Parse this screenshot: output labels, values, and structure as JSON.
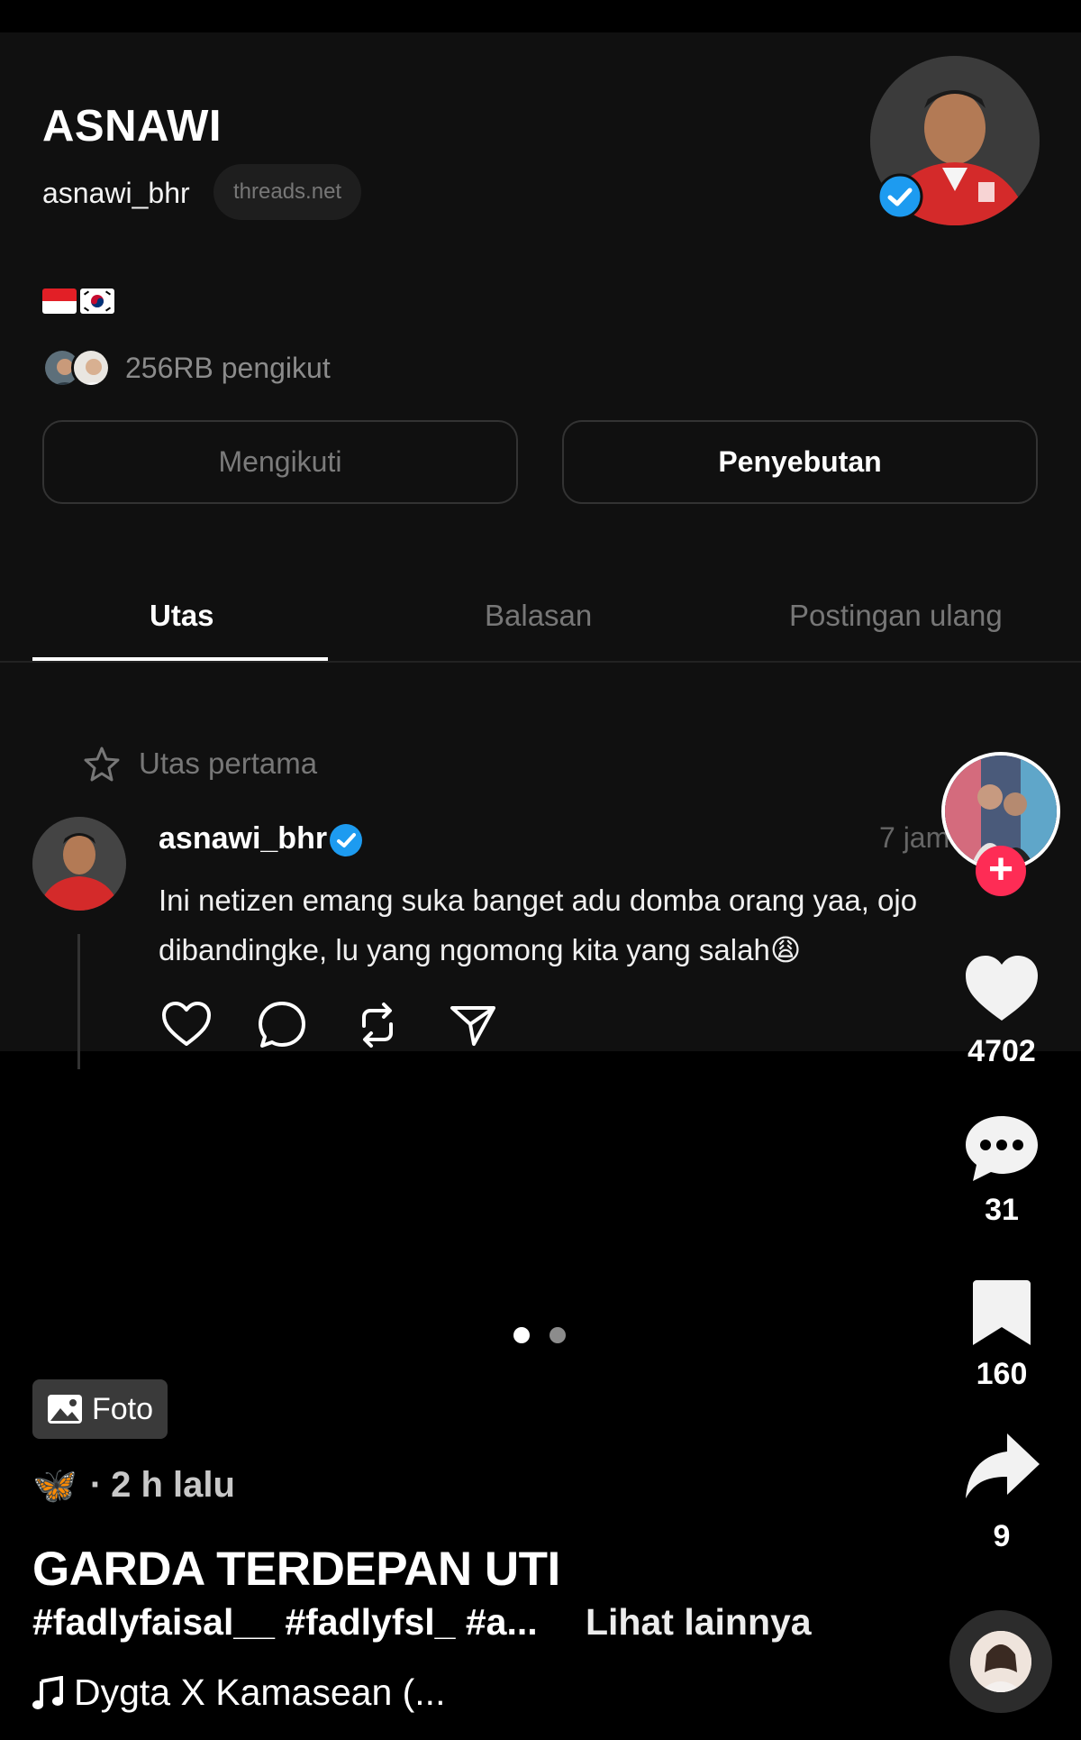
{
  "threads_profile": {
    "name": "ASNAWI",
    "handle": "asnawi_bhr",
    "domain_chip": "threads.net",
    "followers": "256RB pengikut",
    "buttons": {
      "following": "Mengikuti",
      "mention": "Penyebutan"
    },
    "tabs": [
      {
        "label": "Utas",
        "active": true
      },
      {
        "label": "Balasan",
        "active": false
      },
      {
        "label": "Postingan ulang",
        "active": false
      }
    ],
    "pinned_label": "Utas pertama",
    "post": {
      "username": "asnawi_bhr",
      "time": "7 jam",
      "text": "Ini netizen emang suka banget adu domba orang yaa, ojo dibandingke, lu yang ngomong kita yang salah😩"
    }
  },
  "tiktok": {
    "likes": "4702",
    "comments": "31",
    "bookmarks": "160",
    "shares": "9",
    "foto_label": "Foto",
    "author_emoji": "🦋",
    "posted": "2 h lalu",
    "caption_title": "GARDA TERDEPAN UTI",
    "hashtags": "#fadlyfaisal__ #fadlyfsl_ #a...",
    "see_more": "Lihat lainnya",
    "music": "Dygta X Kamasean (..."
  },
  "colors": {
    "background": "#000000",
    "card": "#101010",
    "verified": "#1d9bf0",
    "follow_plus": "#fe2c55",
    "muted_text": "#777777"
  }
}
